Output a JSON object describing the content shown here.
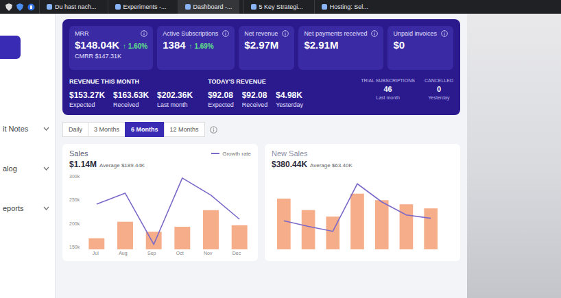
{
  "browser": {
    "tabs": [
      {
        "label": "Du hast nach...",
        "selected": false
      },
      {
        "label": "Experiments -...",
        "selected": false
      },
      {
        "label": "Dashboard -...",
        "selected": true
      },
      {
        "label": "5 Key Strategi...",
        "selected": false
      },
      {
        "label": "Hosting: Sel...",
        "selected": false
      }
    ]
  },
  "sidebar": {
    "items": [
      {
        "label": "it Notes",
        "expanded": false
      },
      {
        "label": "alog",
        "expanded": false
      },
      {
        "label": "eports",
        "expanded": false
      }
    ]
  },
  "metrics": [
    {
      "title": "MRR",
      "value": "$148.04K",
      "change": "↑ 1.60%",
      "sub": "CMRR $147.31K"
    },
    {
      "title": "Active Subscriptions",
      "value": "1384",
      "change": "↑ 1.69%"
    },
    {
      "title": "Net revenue",
      "value": "$2.97M"
    },
    {
      "title": "Net payments received",
      "value": "$2.91M"
    },
    {
      "title": "Unpaid invoices",
      "value": "$0"
    }
  ],
  "revenue_this_month": {
    "title": "REVENUE THIS MONTH",
    "items": [
      {
        "value": "$153.27K",
        "label": "Expected"
      },
      {
        "value": "$163.63K",
        "label": "Received"
      },
      {
        "value": "$202.36K",
        "label": "Last month"
      }
    ]
  },
  "todays_revenue": {
    "title": "TODAY'S REVENUE",
    "items": [
      {
        "value": "$92.08",
        "label": "Expected"
      },
      {
        "value": "$92.08",
        "label": "Received"
      },
      {
        "value": "$4.98K",
        "label": "Yesterday"
      }
    ]
  },
  "subscription_counts": [
    {
      "title": "TRIAL SUBSCRIPTIONS",
      "value": "46",
      "label": "Last month"
    },
    {
      "title": "CANCELLED",
      "value": "0",
      "label": "Yesterday"
    }
  ],
  "periods": [
    {
      "label": "Daily",
      "selected": false
    },
    {
      "label": "3 Months",
      "selected": false
    },
    {
      "label": "6 Months",
      "selected": true
    },
    {
      "label": "12 Months",
      "selected": false
    }
  ],
  "charts": [
    {
      "title": "Sales",
      "total": "$1.14M",
      "average": "Average $189.44K",
      "legend": "Growth rate",
      "ticks": [
        "300k",
        "250k",
        "200k",
        "150k"
      ],
      "months": [
        "Jul",
        "Aug",
        "Sep",
        "Oct",
        "Nov",
        "Dec"
      ],
      "bars": [
        172,
        205,
        185,
        195,
        228,
        198
      ],
      "line": [
        240,
        262,
        160,
        292,
        258,
        210
      ]
    },
    {
      "title": "New Sales",
      "total": "$380.44K",
      "average": "Average $63.40K",
      "bars": [
        62,
        48,
        40,
        68,
        60,
        55,
        50
      ],
      "line": [
        35,
        28,
        22,
        80,
        58,
        42,
        38
      ]
    }
  ]
}
